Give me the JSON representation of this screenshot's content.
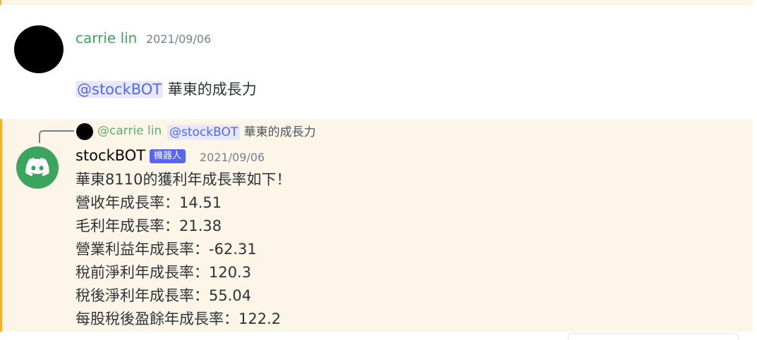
{
  "message1": {
    "author": "carrie lin",
    "timestamp": "2021/09/06",
    "mention": "@stockBOT",
    "text": " 華東的成長力"
  },
  "reply_preview": {
    "author": "@carrie lin",
    "mention": "@stockBOT",
    "text": " 華東的成長力"
  },
  "message2": {
    "author": "stockBOT",
    "badge": "機器人",
    "timestamp": "2021/09/06",
    "lines": [
      "華東8110的獲利年成長率如下！",
      "營收年成長率：14.51",
      "毛利年成長率：21.38",
      "營業利益年成長率：-62.31",
      "稅前淨利年成長率：120.3",
      "稅後淨利年成長率：55.04",
      "每股稅後盈餘年成長率：122.2"
    ]
  },
  "colors": {
    "author_green": "#3ba55d",
    "mention_bg": "#e6e8fd",
    "mention_fg": "#5865f2",
    "highlight_bg": "#fdf5e8",
    "highlight_bar": "#f0b232",
    "badge_bg": "#5865f2"
  }
}
